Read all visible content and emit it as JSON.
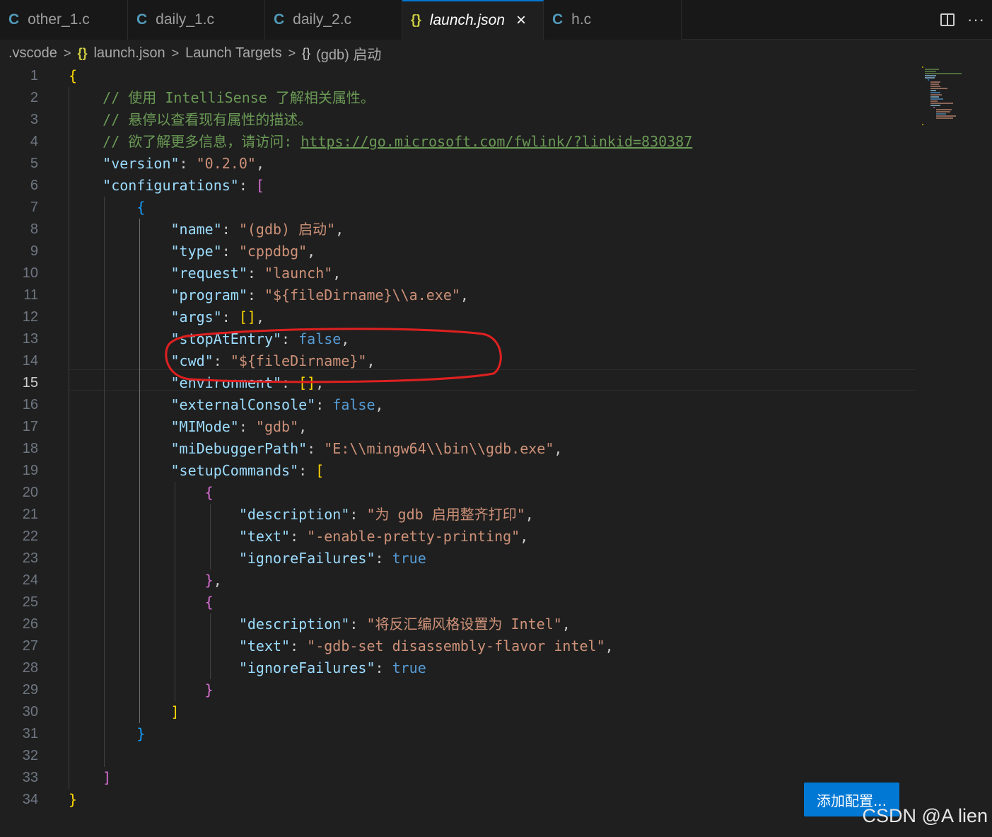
{
  "tabs": [
    {
      "icon": "C",
      "label": "other_1.c"
    },
    {
      "icon": "C",
      "label": "daily_1.c"
    },
    {
      "icon": "C",
      "label": "daily_2.c"
    },
    {
      "icon": "{}",
      "label": "launch.json",
      "close": "×"
    },
    {
      "icon": "C",
      "label": "h.c"
    }
  ],
  "tab_actions": {
    "more": "···"
  },
  "breadcrumb": {
    "folder": ".vscode",
    "file_icon": "{}",
    "file": "launch.json",
    "section": "Launch Targets",
    "item_icon": "{}",
    "item": "(gdb) 启动",
    "sep": ">"
  },
  "line_numbers": [
    "1",
    "2",
    "3",
    "4",
    "5",
    "6",
    "7",
    "8",
    "9",
    "10",
    "11",
    "12",
    "13",
    "14",
    "15",
    "16",
    "17",
    "18",
    "19",
    "20",
    "21",
    "22",
    "23",
    "24",
    "25",
    "26",
    "27",
    "28",
    "29",
    "30",
    "31",
    "32",
    "33",
    "34"
  ],
  "active_line": "15",
  "code": {
    "l1": "{",
    "l2": "// 使用 IntelliSense 了解相关属性。",
    "l3": "// 悬停以查看现有属性的描述。",
    "l4a": "// 欲了解更多信息，请访问: ",
    "l4b": "https://go.microsoft.com/fwlink/?linkid=830387",
    "version_key": "\"version\"",
    "version_val": "\"0.2.0\"",
    "configurations_key": "\"configurations\"",
    "name_key": "\"name\"",
    "name_val": "\"(gdb) 启动\"",
    "type_key": "\"type\"",
    "type_val": "\"cppdbg\"",
    "request_key": "\"request\"",
    "request_val": "\"launch\"",
    "program_key": "\"program\"",
    "program_val": "\"${fileDirname}\\\\a.exe\"",
    "args_key": "\"args\"",
    "stopAtEntry_key": "\"stopAtEntry\"",
    "false": "false",
    "true": "true",
    "cwd_key": "\"cwd\"",
    "cwd_val": "\"${fileDirname}\"",
    "environment_key": "\"environment\"",
    "externalConsole_key": "\"externalConsole\"",
    "MIMode_key": "\"MIMode\"",
    "MIMode_val": "\"gdb\"",
    "miDebuggerPath_key": "\"miDebuggerPath\"",
    "miDebuggerPath_val": "\"E:\\\\mingw64\\\\bin\\\\gdb.exe\"",
    "setupCommands_key": "\"setupCommands\"",
    "description_key": "\"description\"",
    "desc1_val": "\"为 gdb 启用整齐打印\"",
    "text_key": "\"text\"",
    "text1_val": "\"-enable-pretty-printing\"",
    "ignoreFailures_key": "\"ignoreFailures\"",
    "desc2_val": "\"将反汇编风格设置为 Intel\"",
    "text2_val": "\"-gdb-set disassembly-flavor intel\""
  },
  "colors": {
    "key": "#9cdcfe",
    "string": "#ce9178",
    "comment": "#6a9955",
    "boolean": "#569cd6",
    "bracket_gold": "#ffd700",
    "bracket_orchid": "#da70d6",
    "bracket_blue": "#179fff",
    "annotation": "#e02020",
    "button": "#0078d4"
  },
  "add_config_button": "添加配置...",
  "watermark": "CSDN @A lien"
}
